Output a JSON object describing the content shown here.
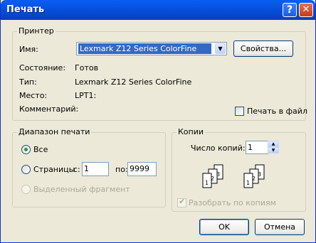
{
  "window": {
    "title": "Печать",
    "help_glyph": "?",
    "close_glyph": "✕"
  },
  "printer": {
    "group_label": "Принтер",
    "name_label": "Имя:",
    "name_value": "Lexmark Z12 Series ColorFine",
    "properties_button": "Свойства...",
    "status_label": "Состояние:",
    "status_value": "Готов",
    "type_label": "Тип:",
    "type_value": "Lexmark Z12 Series ColorFine",
    "location_label": "Место:",
    "location_value": "LPT1:",
    "comment_label": "Комментарий:",
    "print_to_file_label": "Печать в файл",
    "print_to_file_checked": false
  },
  "range": {
    "group_label": "Диапазон печати",
    "all_label": "Все",
    "pages_label": "Страницы",
    "from_label": "с:",
    "from_value": "1",
    "to_label": "по:",
    "to_value": "9999",
    "selection_label": "Выделенный фрагмент",
    "selected": "all"
  },
  "copies": {
    "group_label": "Копии",
    "count_label": "Число копий:",
    "count_value": "1",
    "collate_label": "Разобрать по копиям",
    "collate_checked": true,
    "collate_enabled": false
  },
  "buttons": {
    "ok": "OK",
    "cancel": "Отмена"
  }
}
